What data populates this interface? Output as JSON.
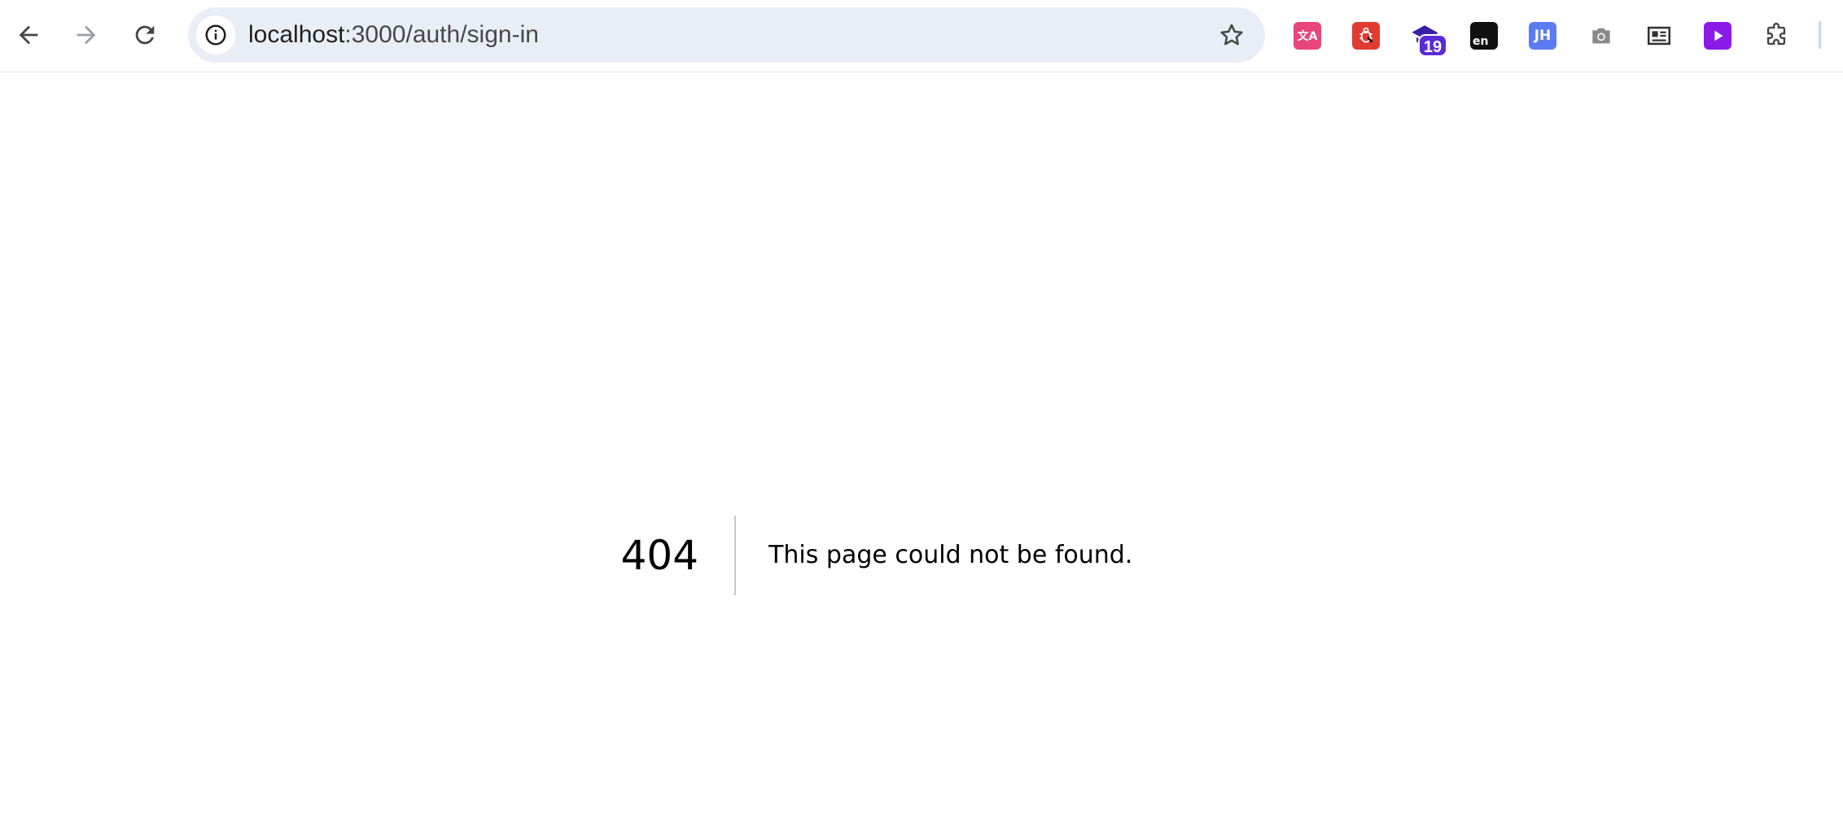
{
  "browser": {
    "address": {
      "host": "localhost",
      "path": ":3000/auth/sign-in"
    },
    "nav": {
      "back_icon": "arrow-left-icon",
      "forward_icon": "arrow-right-icon",
      "reload_icon": "reload-icon"
    },
    "extensions": [
      {
        "name": "translate-extension",
        "glyph": "文A",
        "color": "#e8457a"
      },
      {
        "name": "bug-extension",
        "glyph": "✱",
        "color": "#e03c31"
      },
      {
        "name": "graduation-cap-extension",
        "glyph": "▲",
        "color": "#3b1fa6"
      },
      {
        "name": "dictionary-extension",
        "glyph": "en",
        "color": "#111111"
      },
      {
        "name": "jh-extension",
        "glyph": "JH",
        "color": "#5b7cf0"
      },
      {
        "name": "screenshot-extension",
        "glyph": "◉",
        "color": "#8a8a8a"
      },
      {
        "name": "reader-extension",
        "glyph": "▤",
        "color": "#333333"
      },
      {
        "name": "video-extension",
        "glyph": "▶",
        "color": "#8b1ae8"
      }
    ],
    "badge_count": "19",
    "colors": {
      "toolbar_bg": "#ffffff",
      "omnibox_bg": "#e9eef6",
      "divider": "#c7c7c7"
    }
  },
  "page": {
    "error_code": "404",
    "error_message": "This page could not be found."
  }
}
